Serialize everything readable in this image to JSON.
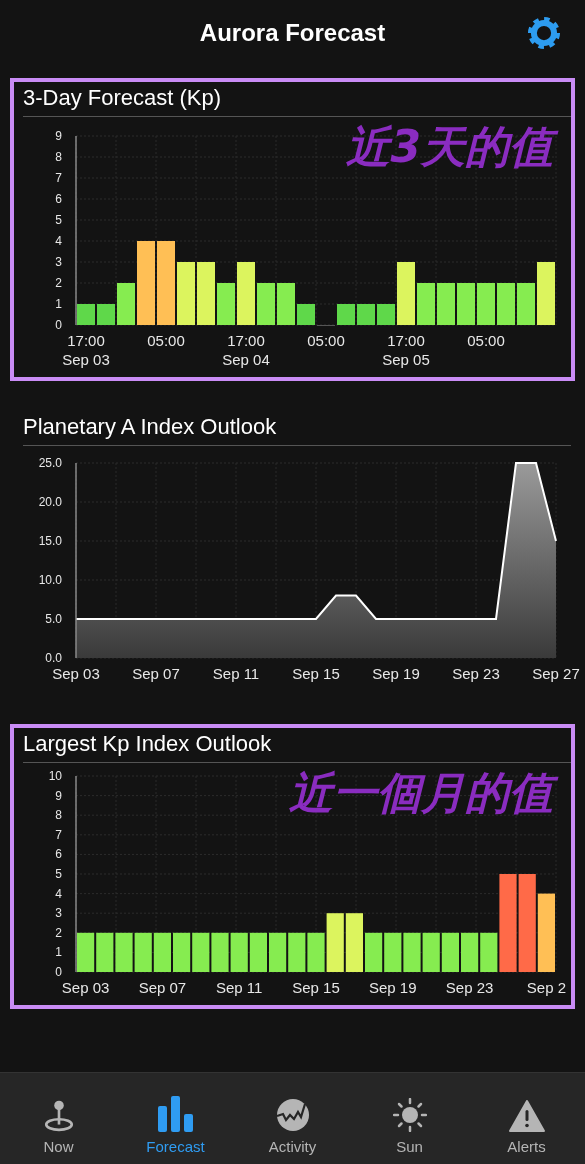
{
  "header": {
    "title": "Aurora Forecast"
  },
  "sections": [
    {
      "title": "3-Day Forecast (Kp)",
      "highlighted": true,
      "annotation": "近3天的值",
      "chart_data": {
        "type": "bar",
        "grid": true,
        "ylim": [
          0,
          9
        ],
        "yticks": [
          0,
          1,
          2,
          3,
          4,
          5,
          6,
          7,
          8,
          9
        ],
        "categories": [
          "17:00\nSep 03",
          null,
          null,
          null,
          "05:00",
          null,
          null,
          null,
          "17:00\nSep 04",
          null,
          null,
          null,
          "05:00",
          null,
          null,
          null,
          "17:00\nSep 05",
          null,
          null,
          null,
          "05:00",
          null,
          null,
          null
        ],
        "values": [
          1,
          1,
          2,
          4,
          4,
          3,
          3,
          2,
          3,
          2,
          2,
          1,
          0,
          1,
          1,
          1,
          3,
          2,
          2,
          2,
          2,
          2,
          2,
          3
        ]
      }
    },
    {
      "title": "Planetary A Index Outlook",
      "highlighted": false,
      "chart_data": {
        "type": "area",
        "grid": true,
        "ylim": [
          0,
          25
        ],
        "yticks": [
          {
            "value": 0,
            "label": "0.0"
          },
          {
            "value": 5,
            "label": "5.0"
          },
          {
            "value": 10,
            "label": "10.0"
          },
          {
            "value": 15,
            "label": "15.0"
          },
          {
            "value": 20,
            "label": "20.0"
          },
          {
            "value": 25,
            "label": "25.0"
          }
        ],
        "categories": [
          "Sep 03",
          null,
          null,
          null,
          "Sep 07",
          null,
          null,
          null,
          "Sep 11",
          null,
          null,
          null,
          "Sep 15",
          null,
          null,
          null,
          "Sep 19",
          null,
          null,
          null,
          "Sep 23",
          null,
          null,
          null,
          "Sep 27"
        ],
        "values": [
          5,
          5,
          5,
          5,
          5,
          5,
          5,
          5,
          5,
          5,
          5,
          5,
          5,
          8,
          8,
          5,
          5,
          5,
          5,
          5,
          5,
          5,
          25,
          25,
          15
        ]
      }
    },
    {
      "title": "Largest Kp Index Outlook",
      "highlighted": true,
      "annotation": "近一個月的值",
      "chart_data": {
        "type": "bar",
        "grid": true,
        "ylim": [
          0,
          10
        ],
        "yticks": [
          0,
          1,
          2,
          3,
          4,
          5,
          6,
          7,
          8,
          9,
          10
        ],
        "categories": [
          "Sep 03",
          null,
          null,
          null,
          "Sep 07",
          null,
          null,
          null,
          "Sep 11",
          null,
          null,
          null,
          "Sep 15",
          null,
          null,
          null,
          "Sep 19",
          null,
          null,
          null,
          "Sep 23",
          null,
          null,
          null,
          "Sep 2"
        ],
        "values": [
          2,
          2,
          2,
          2,
          2,
          2,
          2,
          2,
          2,
          2,
          2,
          2,
          2,
          3,
          3,
          2,
          2,
          2,
          2,
          2,
          2,
          2,
          5,
          5,
          4
        ]
      }
    }
  ],
  "tab_bar": [
    {
      "label": "Now",
      "kind": "pin",
      "selected": false
    },
    {
      "label": "Forecast",
      "kind": "bars",
      "selected": true
    },
    {
      "label": "Activity",
      "kind": "activity",
      "selected": false
    },
    {
      "label": "Sun",
      "kind": "sun",
      "selected": false
    },
    {
      "label": "Alerts",
      "kind": "alert",
      "selected": false
    }
  ]
}
